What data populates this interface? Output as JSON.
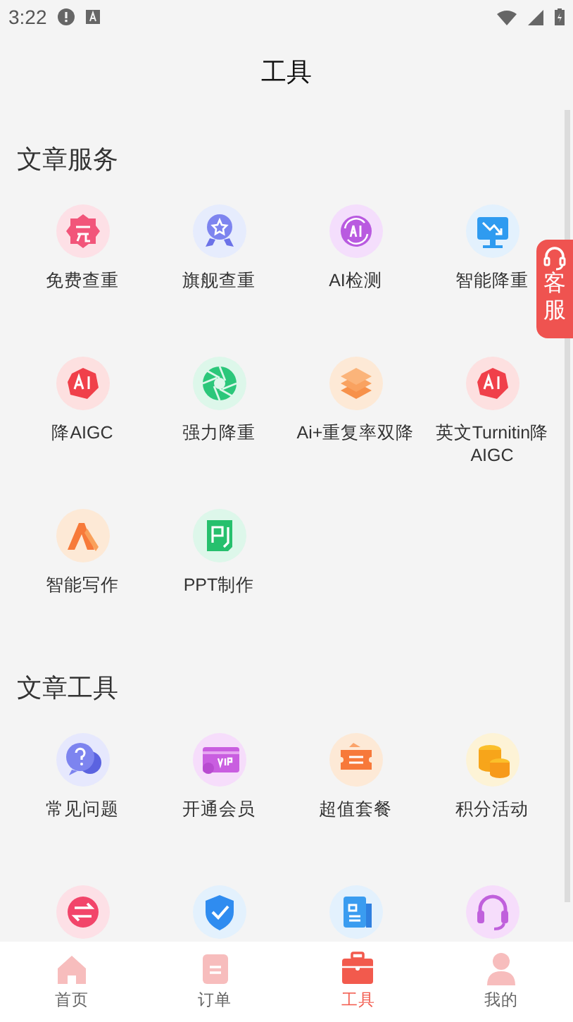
{
  "status_bar": {
    "time": "3:22"
  },
  "header": {
    "title": "工具"
  },
  "sections": [
    {
      "title": "文章服务",
      "items": [
        {
          "label": "免费查重"
        },
        {
          "label": "旗舰查重"
        },
        {
          "label": "AI检测"
        },
        {
          "label": "智能降重"
        },
        {
          "label": "降AIGC"
        },
        {
          "label": "强力降重"
        },
        {
          "label": "Ai+重复率双降"
        },
        {
          "label": "英文Turnitin降AIGC"
        },
        {
          "label": "智能写作"
        },
        {
          "label": "PPT制作"
        }
      ]
    },
    {
      "title": "文章工具",
      "items": [
        {
          "label": "常见问题"
        },
        {
          "label": "开通会员"
        },
        {
          "label": "超值套餐"
        },
        {
          "label": "积分活动"
        },
        {
          "kind": "icon_only"
        },
        {
          "kind": "icon_only"
        },
        {
          "kind": "icon_only"
        },
        {
          "kind": "icon_only"
        }
      ]
    }
  ],
  "float_service": {
    "label": "客服"
  },
  "tab_bar": [
    {
      "label": "首页",
      "selected": false
    },
    {
      "label": "订单",
      "selected": false
    },
    {
      "label": "工具",
      "selected": true
    },
    {
      "label": "我的",
      "selected": false
    }
  ]
}
